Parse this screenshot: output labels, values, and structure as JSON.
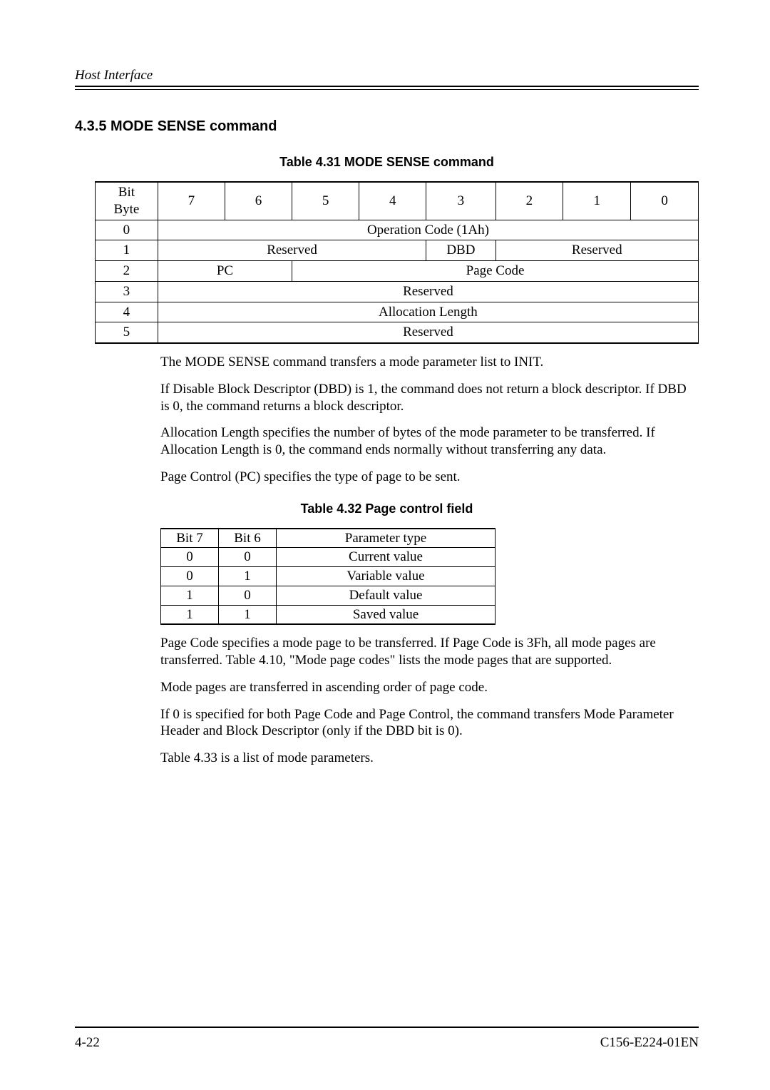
{
  "header": {
    "running_title": "Host Interface"
  },
  "section": {
    "number_title": "4.3.5  MODE SENSE command"
  },
  "table1": {
    "caption": "Table 4.31  MODE SENSE command",
    "header_cell": "Bit\nByte",
    "bits": [
      "7",
      "6",
      "5",
      "4",
      "3",
      "2",
      "1",
      "0"
    ],
    "rows": [
      {
        "byte": "0",
        "cells": [
          {
            "span": 8,
            "text": "Operation Code (1Ah)"
          }
        ]
      },
      {
        "byte": "1",
        "cells": [
          {
            "span": 4,
            "text": "Reserved"
          },
          {
            "span": 1,
            "text": "DBD"
          },
          {
            "span": 3,
            "text": "Reserved"
          }
        ]
      },
      {
        "byte": "2",
        "cells": [
          {
            "span": 2,
            "text": "PC"
          },
          {
            "span": 6,
            "text": "Page Code"
          }
        ]
      },
      {
        "byte": "3",
        "cells": [
          {
            "span": 8,
            "text": "Reserved"
          }
        ]
      },
      {
        "byte": "4",
        "cells": [
          {
            "span": 8,
            "text": "Allocation Length"
          }
        ]
      },
      {
        "byte": "5",
        "cells": [
          {
            "span": 8,
            "text": "Reserved"
          }
        ]
      }
    ]
  },
  "paras": {
    "p1": "The MODE SENSE command transfers a mode parameter list to INIT.",
    "p2": "If Disable Block Descriptor (DBD) is 1, the command does not return a block descriptor.  If DBD is 0, the command returns a block descriptor.",
    "p3": "Allocation Length specifies the number of bytes of the mode parameter to be transferred.  If Allocation Length is 0, the command ends normally without transferring any data.",
    "p4": "Page Control (PC) specifies the type of page to be sent.",
    "p5": "Page Code specifies a mode page to be transferred.  If Page Code is 3Fh, all mode pages are transferred.  Table 4.10, \"Mode page codes\" lists the mode pages that are supported.",
    "p6": "Mode pages are transferred in ascending order of page code.",
    "p7": "If 0 is specified for both Page Code and Page Control, the command transfers Mode Parameter Header and Block Descriptor (only if the DBD bit is 0).",
    "p8": "Table 4.33 is a list of mode parameters."
  },
  "table2": {
    "caption": "Table 4.32  Page control field",
    "headers": [
      "Bit 7",
      "Bit 6",
      "Parameter type"
    ],
    "rows": [
      [
        "0",
        "0",
        "Current value"
      ],
      [
        "0",
        "1",
        "Variable value"
      ],
      [
        "1",
        "0",
        "Default value"
      ],
      [
        "1",
        "1",
        "Saved value"
      ]
    ]
  },
  "footer": {
    "page": "4-22",
    "doc": "C156-E224-01EN"
  }
}
